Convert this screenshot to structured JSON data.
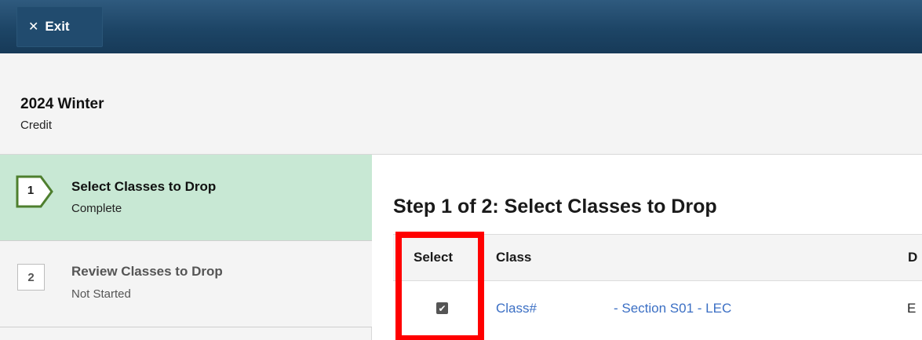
{
  "topbar": {
    "exit_label": "Exit",
    "exit_icon": "close-icon"
  },
  "term": {
    "title": "2024 Winter",
    "career": "Credit"
  },
  "steps": [
    {
      "number": "1",
      "title": "Select Classes to Drop",
      "status": "Complete"
    },
    {
      "number": "2",
      "title": "Review Classes to Drop",
      "status": "Not Started"
    }
  ],
  "main": {
    "title": "Step 1 of 2: Select Classes to Drop",
    "columns": {
      "select": "Select",
      "class": "Class",
      "description": "D"
    },
    "rows": [
      {
        "selected": true,
        "class_number": "Class#",
        "section": "- Section S01 - LEC",
        "description": "E"
      }
    ]
  },
  "colors": {
    "topbar": "#1d4566",
    "active_step": "#c8e8d4",
    "link": "#3b6fc4",
    "highlight": "#ff0000"
  }
}
